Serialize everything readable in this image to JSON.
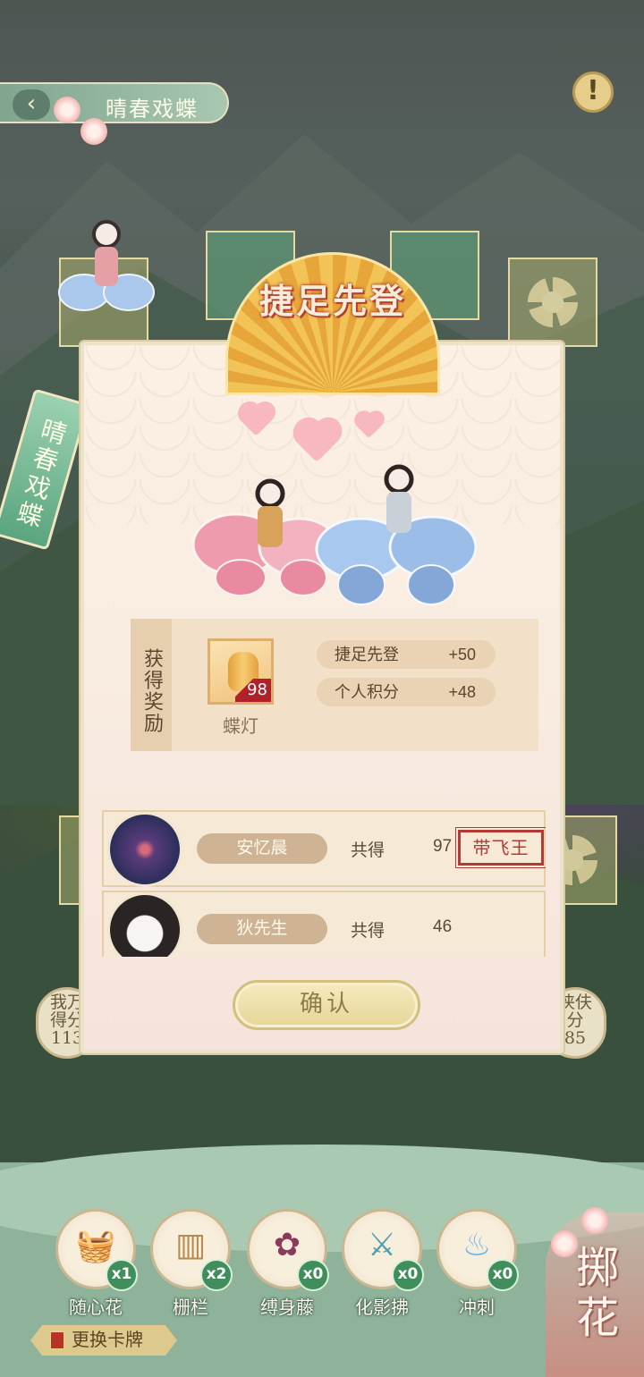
{
  "header": {
    "back_glyph": "‹",
    "title": "晴春戏蝶",
    "info_glyph": "!"
  },
  "tag": {
    "text": "晴春戏蝶"
  },
  "banner": {
    "text": "捷足先登"
  },
  "reward": {
    "label": "获得奖励",
    "item": {
      "name": "蝶灯",
      "count": "98"
    },
    "scores": [
      {
        "label": "捷足先登",
        "value": "+50"
      },
      {
        "label": "个人积分",
        "value": "+48"
      }
    ]
  },
  "ranking": [
    {
      "name": "安忆晨",
      "gain_label": "共得",
      "gain_value": "97",
      "stamp": "带飞王"
    },
    {
      "name": "狄先生",
      "gain_label": "共得",
      "gain_value": "46",
      "stamp": ""
    }
  ],
  "confirm_label": "确认",
  "side_scores": {
    "left": {
      "line1": "我万",
      "line2": "得分",
      "value": "113"
    },
    "right": {
      "line1": "侠伕",
      "line2": "分",
      "value": "85"
    }
  },
  "tools": [
    {
      "name": "随心花",
      "count": "x1",
      "icon": "flower-basket-icon"
    },
    {
      "name": "栅栏",
      "count": "x2",
      "icon": "fence-icon"
    },
    {
      "name": "缚身藤",
      "count": "x0",
      "icon": "vine-plant-icon"
    },
    {
      "name": "化影拂",
      "count": "x0",
      "icon": "whisk-icon"
    },
    {
      "name": "冲刺",
      "count": "x0",
      "icon": "blue-flame-icon"
    }
  ],
  "switch_card_label": "更换卡牌",
  "throw_label": "掷花",
  "colors": {
    "accent_green": "#3f8e5c",
    "stamp_red": "#b43a36",
    "banner_gold": "#f2c458"
  }
}
